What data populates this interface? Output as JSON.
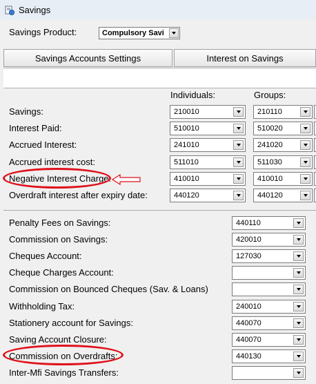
{
  "window": {
    "title": "Savings"
  },
  "product": {
    "label": "Savings Product:",
    "value": "Compulsory Savi"
  },
  "tabs": [
    {
      "label": "Savings Accounts Settings"
    },
    {
      "label": "Interest on Savings"
    }
  ],
  "columns": {
    "individuals": "Individuals:",
    "groups": "Groups:"
  },
  "top_rows": [
    {
      "label": "Savings:",
      "individual": "210010",
      "group": "210110"
    },
    {
      "label": "Interest Paid:",
      "individual": "510010",
      "group": "510020"
    },
    {
      "label": "Accrued Interest:",
      "individual": "241010",
      "group": "241020"
    },
    {
      "label": "Accrued interest cost:",
      "individual": "511010",
      "group": "511030"
    },
    {
      "label": "Negative Interest Charge:",
      "individual": "410010",
      "group": "410010"
    },
    {
      "label": "Overdraft interest after expiry date:",
      "individual": "440120",
      "group": "440120"
    }
  ],
  "bottom_rows": [
    {
      "label": "Penalty Fees on Savings:",
      "value": "440110"
    },
    {
      "label": "Commission on Savings:",
      "value": "420010"
    },
    {
      "label": "Cheques Account:",
      "value": "127030"
    },
    {
      "label": "Cheque Charges Account:",
      "value": ""
    },
    {
      "label": "Commission on Bounced Cheques (Sav. & Loans)",
      "value": ""
    },
    {
      "label": "Withholding Tax:",
      "value": "240010"
    },
    {
      "label": "Stationery account for Savings:",
      "value": "440070"
    },
    {
      "label": "Saving Account Closure:",
      "value": "440070"
    },
    {
      "label": "Commission on Overdrafts:",
      "value": "440130"
    },
    {
      "label": "Inter-Mfi Savings Transfers:",
      "value": ""
    }
  ],
  "annotations": {
    "highlight_color": "#e0101a"
  }
}
